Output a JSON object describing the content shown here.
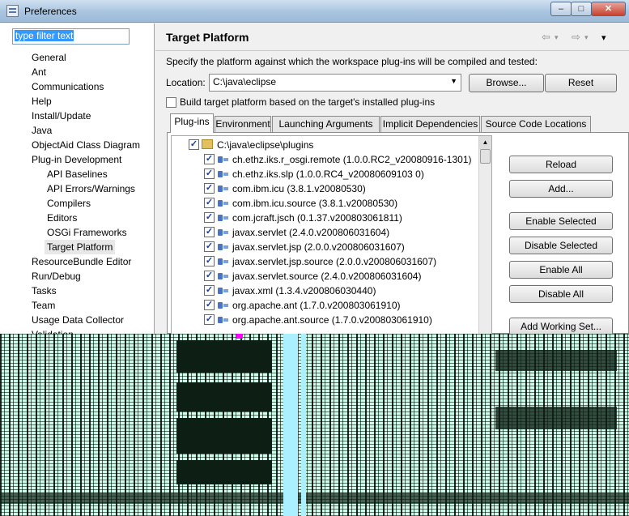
{
  "window": {
    "title": "Preferences",
    "controls": {
      "minimize": "–",
      "maximize": "□",
      "close": "✕"
    }
  },
  "left": {
    "filter_text": "type filter text",
    "tree": [
      {
        "label": "General",
        "level": 0
      },
      {
        "label": "Ant",
        "level": 0
      },
      {
        "label": "Communications",
        "level": 0
      },
      {
        "label": "Help",
        "level": 0
      },
      {
        "label": "Install/Update",
        "level": 0
      },
      {
        "label": "Java",
        "level": 0
      },
      {
        "label": "ObjectAid Class Diagram",
        "level": 0
      },
      {
        "label": "Plug-in Development",
        "level": 0
      },
      {
        "label": "API Baselines",
        "level": 1
      },
      {
        "label": "API Errors/Warnings",
        "level": 1
      },
      {
        "label": "Compilers",
        "level": 1
      },
      {
        "label": "Editors",
        "level": 1
      },
      {
        "label": "OSGi Frameworks",
        "level": 1
      },
      {
        "label": "Target Platform",
        "level": 1,
        "selected": true
      },
      {
        "label": "ResourceBundle Editor",
        "level": 0
      },
      {
        "label": "Run/Debug",
        "level": 0
      },
      {
        "label": "Tasks",
        "level": 0
      },
      {
        "label": "Team",
        "level": 0
      },
      {
        "label": "Usage Data Collector",
        "level": 0
      },
      {
        "label": "Validation",
        "level": 0
      }
    ]
  },
  "right": {
    "title": "Target Platform",
    "nav": {
      "back": "⇦",
      "back_drop": "▾",
      "forward": "⇨",
      "forward_drop": "▾",
      "menu": "▾"
    },
    "description": "Specify the platform against which the workspace plug-ins will be compiled and tested:",
    "location_label": "Location:",
    "location_value": "C:\\java\\eclipse",
    "browse_label": "Browse...",
    "reset_label": "Reset",
    "build_checkbox_label": "Build target platform based on the target's installed plug-ins",
    "tabs": [
      "Plug-ins",
      "Environment",
      "Launching Arguments",
      "Implicit Dependencies",
      "Source Code Locations"
    ],
    "root_folder": "C:\\java\\eclipse\\plugins",
    "plugins": [
      "ch.ethz.iks.r_osgi.remote (1.0.0.RC2_v20080916-1301)",
      "ch.ethz.iks.slp (1.0.0.RC4_v20080609103 0)",
      "com.ibm.icu (3.8.1.v20080530)",
      "com.ibm.icu.source (3.8.1.v20080530)",
      "com.jcraft.jsch (0.1.37.v200803061811)",
      "javax.servlet (2.4.0.v200806031604)",
      "javax.servlet.jsp (2.0.0.v200806031607)",
      "javax.servlet.jsp.source (2.0.0.v200806031607)",
      "javax.servlet.source (2.4.0.v200806031604)",
      "javax.xml (1.3.4.v200806030440)",
      "org.apache.ant (1.7.0.v200803061910)",
      "org.apache.ant.source (1.7.0.v200803061910)"
    ],
    "buttons": [
      "Reload",
      "Add...",
      "Enable Selected",
      "Disable Selected",
      "Enable All",
      "Disable All",
      "Add Working Set..."
    ]
  }
}
